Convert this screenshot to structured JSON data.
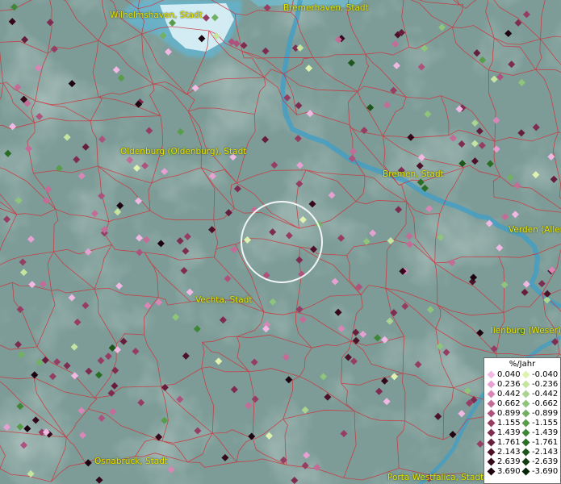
{
  "cities": [
    {
      "name": "Wilhelmshaven, Stadt"
    },
    {
      "name": "Bremerhaven, Stadt"
    },
    {
      "name": "Oldenburg (Oldenburg), Stadt"
    },
    {
      "name": "Bremen, Stadt"
    },
    {
      "name": "Verden (Aller)"
    },
    {
      "name": "Vechta, Stadt"
    },
    {
      "name": "Nienburg (Weser)"
    },
    {
      "name": "Osnabrück, Stadt"
    },
    {
      "name": "Porta Westfalica, Stadt"
    }
  ],
  "legend": {
    "title": "%/Jahr",
    "rows": [
      {
        "pos": "0.040",
        "neg": "-0.040",
        "pos_color": "#f2b8e4",
        "neg_color": "#dff2b0"
      },
      {
        "pos": "0.236",
        "neg": "-0.236",
        "pos_color": "#e6a0d2",
        "neg_color": "#c5e4a0"
      },
      {
        "pos": "0.442",
        "neg": "-0.442",
        "pos_color": "#d886b6",
        "neg_color": "#aad48f"
      },
      {
        "pos": "0.662",
        "neg": "-0.662",
        "pos_color": "#c46c98",
        "neg_color": "#8ec47c"
      },
      {
        "pos": "0.899",
        "neg": "-0.899",
        "pos_color": "#ad527c",
        "neg_color": "#72b064"
      },
      {
        "pos": "1.155",
        "neg": "-1.155",
        "pos_color": "#963d64",
        "neg_color": "#589c4c"
      },
      {
        "pos": "1.439",
        "neg": "-1.439",
        "pos_color": "#7e2c50",
        "neg_color": "#3f8636"
      },
      {
        "pos": "1.761",
        "neg": "-1.761",
        "pos_color": "#661e3c",
        "neg_color": "#2a6e26"
      },
      {
        "pos": "2.143",
        "neg": "-2.143",
        "pos_color": "#4d122a",
        "neg_color": "#1c561a"
      },
      {
        "pos": "2.639",
        "neg": "-2.639",
        "pos_color": "#35081a",
        "neg_color": "#113d10"
      },
      {
        "pos": "3.690",
        "neg": "-3.690",
        "pos_color": "#1e0410",
        "neg_color": "#072607"
      }
    ]
  }
}
